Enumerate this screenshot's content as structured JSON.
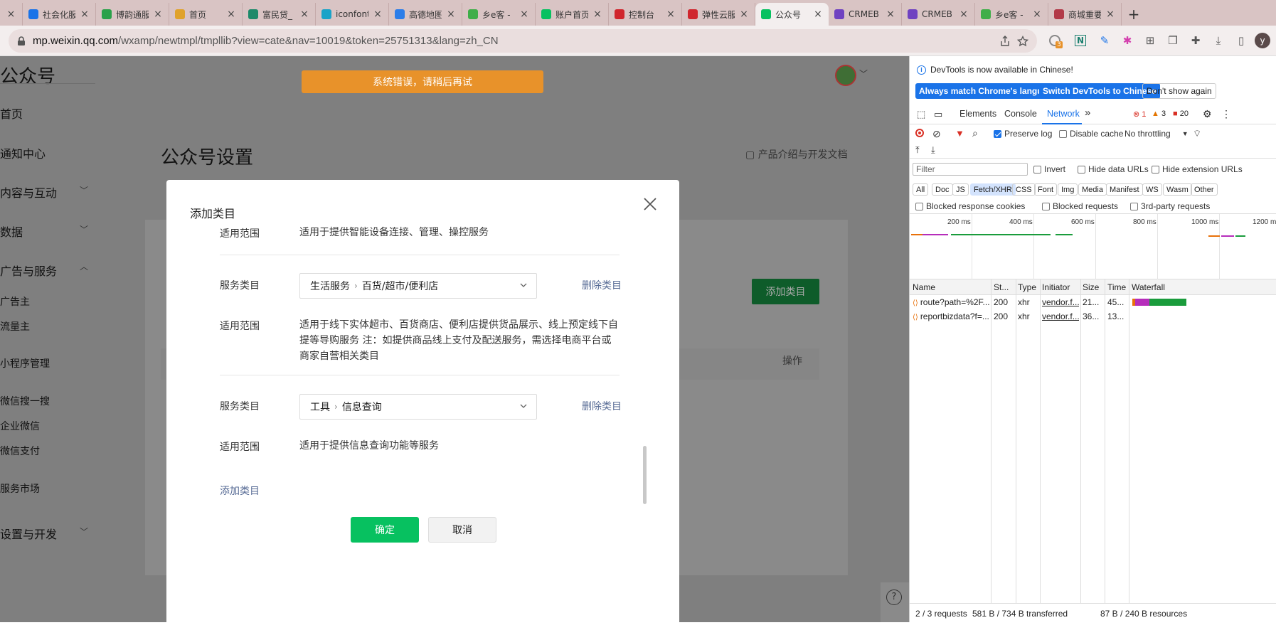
{
  "browser": {
    "tabs": [
      {
        "label": "",
        "close": "×",
        "color": "#cc3b3b"
      },
      {
        "label": "社会化服",
        "close": "×",
        "color": "#1a73e8"
      },
      {
        "label": "博韵通服",
        "close": "×",
        "color": "#2aa14a"
      },
      {
        "label": "首页",
        "close": "×",
        "color": "#e0a22a"
      },
      {
        "label": "富民贷_",
        "close": "×",
        "color": "#1d8a6a"
      },
      {
        "label": "iconfont",
        "close": "×",
        "color": "#1aa3c8"
      },
      {
        "label": "高德地图",
        "close": "×",
        "color": "#2b7de9"
      },
      {
        "label": "乡e客 -",
        "close": "×",
        "color": "#3fae49"
      },
      {
        "label": "账户首页",
        "close": "×",
        "color": "#07c160"
      },
      {
        "label": "控制台",
        "close": "×",
        "color": "#d0262d"
      },
      {
        "label": "弹性云服",
        "close": "×",
        "color": "#d0262d"
      },
      {
        "label": "公众号",
        "close": "×",
        "color": "#07c160"
      },
      {
        "label": "CRMEB",
        "close": "×",
        "color": "#6f42c1"
      },
      {
        "label": "CRMEB",
        "close": "×",
        "color": "#6f42c1"
      },
      {
        "label": "乡e客 -",
        "close": "×",
        "color": "#3fae49"
      },
      {
        "label": "商城重要",
        "close": "×",
        "color": "#b23a48"
      }
    ],
    "new_tab": "+",
    "url_host": "mp.weixin.qq.com",
    "url_path": "/wxamp/newtmpl/tmpllib?view=cate&nav=10019&token=25751313&lang=zh_CN",
    "badge_count": "3",
    "profile_initial": "y"
  },
  "page": {
    "logo": "公众号",
    "error_message": "系统错误，请稍后再试",
    "title": "公众号设置",
    "doc_link": "产品介绍与开发文档",
    "add_category_button": "添加类目",
    "operation_column": "操作",
    "help_label": "?",
    "nav": {
      "home": "首页",
      "notifications": "通知中心",
      "content": "内容与互动",
      "data": "数据",
      "ads": "广告与服务",
      "advertiser": "广告主",
      "publisher": "流量主",
      "miniprogram": "小程序管理",
      "search": "微信搜一搜",
      "work_wechat": "企业微信",
      "wechat_pay": "微信支付",
      "service_market": "服务市场",
      "settings": "设置与开发"
    }
  },
  "modal": {
    "title": "添加类目",
    "scope_label": "适用范围",
    "category_label": "服务类目",
    "scope_1": "适用于提供智能设备连接、管理、操控服务",
    "category_2_primary": "生活服务",
    "category_2_secondary": "百货/超市/便利店",
    "scope_2": "适用于线下实体超市、百货商店、便利店提供货品展示、线上预定线下自提等导购服务 注：如提供商品线上支付及配送服务，需选择电商平台或商家自营相关类目",
    "category_3_primary": "工具",
    "category_3_secondary": "信息查询",
    "scope_3": "适用于提供信息查询功能等服务",
    "delete_link": "删除类目",
    "add_link": "添加类目",
    "confirm": "确定",
    "cancel": "取消",
    "separator_glyph": "›"
  },
  "devtools": {
    "notice": "DevTools is now available in Chinese!",
    "btn_match": "Always match Chrome's language",
    "btn_switch": "Switch DevTools to Chinese",
    "btn_dismiss": "Don't show again",
    "tabs": [
      "Elements",
      "Console",
      "Network"
    ],
    "active_tab": "Network",
    "more_tabs": "»",
    "errors": "1",
    "warnings": "3",
    "issues": "20",
    "preserve_log": "Preserve log",
    "disable_cache": "Disable cache",
    "throttling": "No throttling",
    "filter_placeholder": "Filter",
    "invert": "Invert",
    "hide_data_urls": "Hide data URLs",
    "hide_extension_urls": "Hide extension URLs",
    "type_filters": [
      "All",
      "Doc",
      "JS",
      "Fetch/XHR",
      "CSS",
      "Font",
      "Img",
      "Media",
      "Manifest",
      "WS",
      "Wasm",
      "Other"
    ],
    "selected_type": "Fetch/XHR",
    "blocked_cookies": "Blocked response cookies",
    "blocked_requests": "Blocked requests",
    "third_party": "3rd-party requests",
    "timeline_ticks": [
      "200 ms",
      "400 ms",
      "600 ms",
      "800 ms",
      "1000 ms",
      "1200 m"
    ],
    "columns": {
      "name": "Name",
      "status": "St...",
      "type": "Type",
      "initiator": "Initiator",
      "size": "Size",
      "time": "Time",
      "waterfall": "Waterfall"
    },
    "requests": [
      {
        "name": "route?path=%2F...",
        "status": "200",
        "type": "xhr",
        "initiator": "vendor.f...",
        "size": "21...",
        "time": "45..."
      },
      {
        "name": "reportbizdata?f=...",
        "status": "200",
        "type": "xhr",
        "initiator": "vendor.f...",
        "size": "36...",
        "time": "13..."
      }
    ],
    "summary_requests": "2 / 3 requests",
    "summary_transferred": "581 B / 734 B transferred",
    "summary_resources": "87 B / 240 B resources"
  }
}
